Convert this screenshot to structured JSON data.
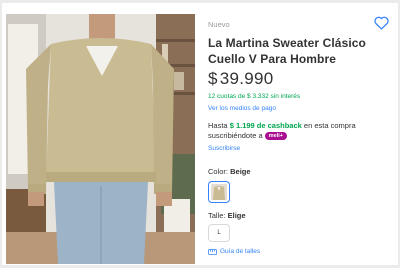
{
  "product": {
    "condition": "Nuevo",
    "title": "La Martina Sweater Clásico Cuello V Para Hombre",
    "price": {
      "currency": "$",
      "amount": "39.990"
    },
    "installments": "12 cuotas de $ 3.332 sin interés",
    "payment_link": "Ver los medios de pago",
    "cashback": {
      "prefix": "Hasta",
      "amount": "$ 1.199 de cashback",
      "suffix": "en esta compra suscribiéndote a",
      "badge": "meli+"
    },
    "subscribe_link": "Suscribirse",
    "color": {
      "label": "Color:",
      "value": "Beige"
    },
    "size": {
      "label": "Talle:",
      "value": "Elige",
      "options": [
        "L"
      ]
    },
    "size_guide": "Guía de talles"
  },
  "icons": {
    "favorite": "heart-icon",
    "size_guide": "ruler-icon"
  },
  "colors": {
    "accent_blue": "#3483fa",
    "green": "#00a650",
    "meli_purple": "#a90f90",
    "sweater_beige": "#c9bb92"
  }
}
